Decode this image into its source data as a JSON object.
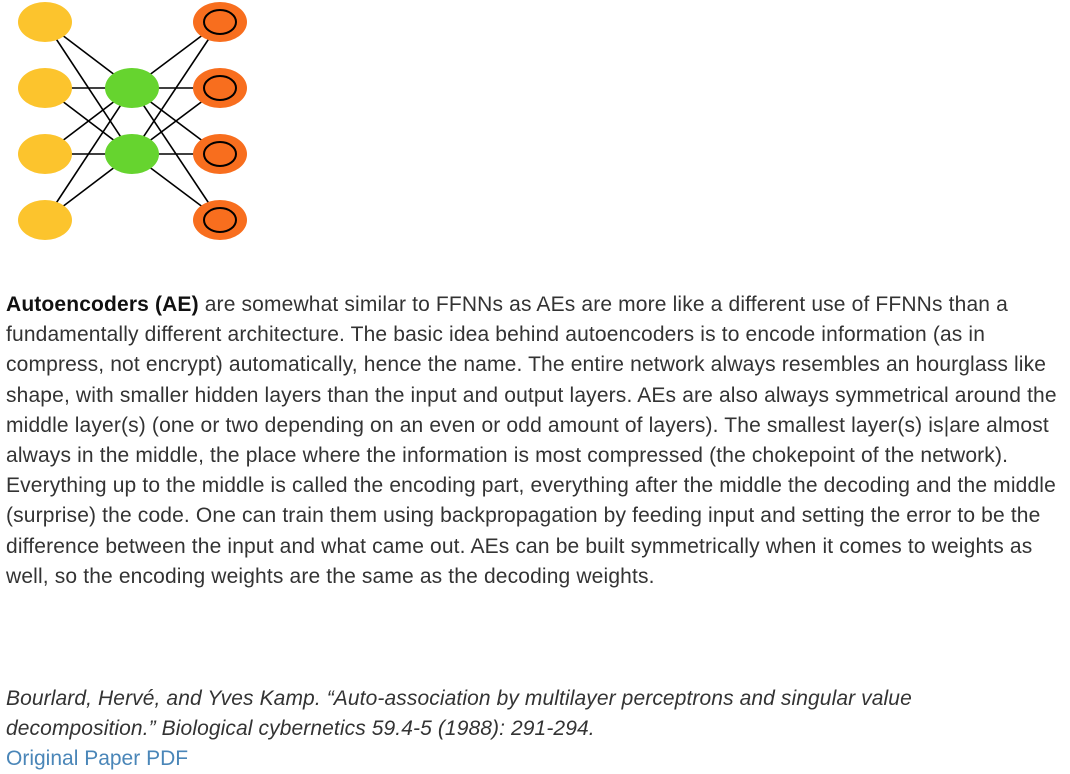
{
  "diagram": {
    "colors": {
      "input_cell": "#fcc42d",
      "hidden_cell": "#66d42f",
      "output_cell": "#f86e1e",
      "output_cell_ring": "#000000",
      "connection": "#000000"
    },
    "layers": [
      {
        "name": "input",
        "cells": 4
      },
      {
        "name": "hidden",
        "cells": 2
      },
      {
        "name": "output",
        "cells": 4
      }
    ]
  },
  "article": {
    "lead": "Autoencoders (AE)",
    "body": " are somewhat similar to FFNNs as AEs are more like a different use of FFNNs than a fundamentally different architecture. The basic idea behind autoencoders is to encode information (as in compress, not encrypt) automatically, hence the name. The entire network always resembles an hourglass like shape, with smaller hidden layers than the input and output layers. AEs are also always symmetrical around the middle layer(s) (one or two depending on an even or odd amount of layers). The smallest layer(s) is|are almost always in the middle, the place where the information is most compressed (the chokepoint of the network). Everything up to the middle is called the encoding part, everything after the middle the decoding and the middle (surprise) the code. One can train them using backpropagation by feeding input and setting the error to be the difference between the input and what came out. AEs can be built symmetrically when it comes to weights as well, so the encoding weights are the same as the decoding weights."
  },
  "citation": {
    "text": "Bourlard, Hervé, and Yves Kamp. “Auto-association by multilayer perceptrons and singular value decomposition.” Biological cybernetics 59.4-5 (1988): 291-294."
  },
  "link": {
    "label": "Original Paper PDF"
  }
}
